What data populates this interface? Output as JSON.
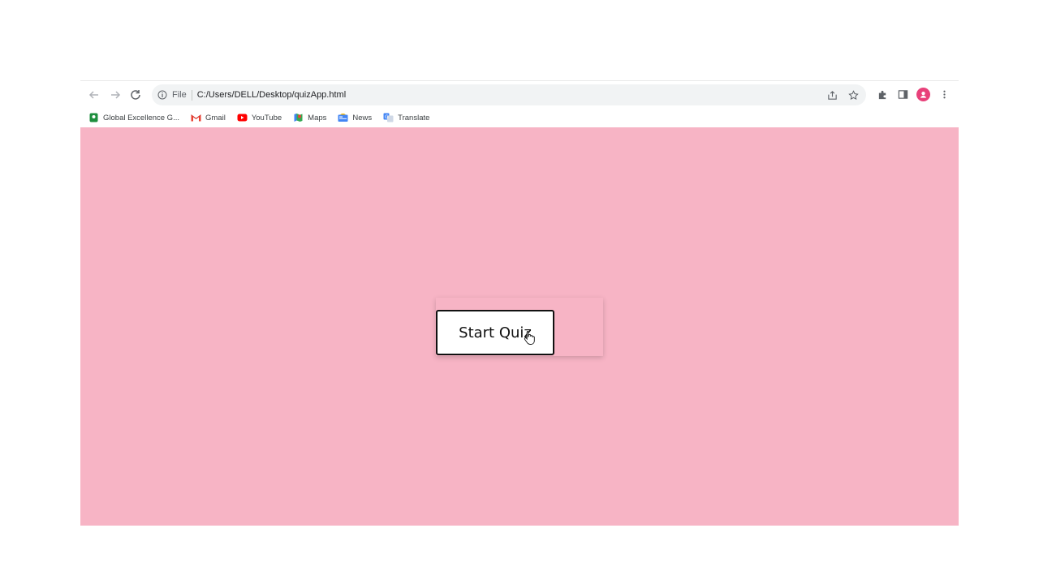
{
  "browser": {
    "omnibox": {
      "scheme": "File",
      "url": "C:/Users/DELL/Desktop/quizApp.html"
    },
    "icons": {
      "back": "arrow-left-icon",
      "forward": "arrow-right-icon",
      "reload": "reload-icon",
      "info": "info-icon",
      "share": "share-icon",
      "bookmark": "star-icon",
      "extensions": "puzzle-icon",
      "sidepanel": "side-panel-icon",
      "profile": "avatar",
      "menu": "kebab-menu-icon"
    },
    "bookmarks": [
      {
        "label": "Global Excellence G...",
        "icon": "globe-badge-icon",
        "color": "#1e8e3e"
      },
      {
        "label": "Gmail",
        "icon": "gmail-icon",
        "color": "#ea4335"
      },
      {
        "label": "YouTube",
        "icon": "youtube-icon",
        "color": "#ff0000"
      },
      {
        "label": "Maps",
        "icon": "maps-icon",
        "color": "#34a853"
      },
      {
        "label": "News",
        "icon": "news-icon",
        "color": "#4285f4"
      },
      {
        "label": "Translate",
        "icon": "translate-icon",
        "color": "#4285f4"
      }
    ]
  },
  "page": {
    "background": "#f7b4c5",
    "start_button_label": "Start Quiz"
  }
}
